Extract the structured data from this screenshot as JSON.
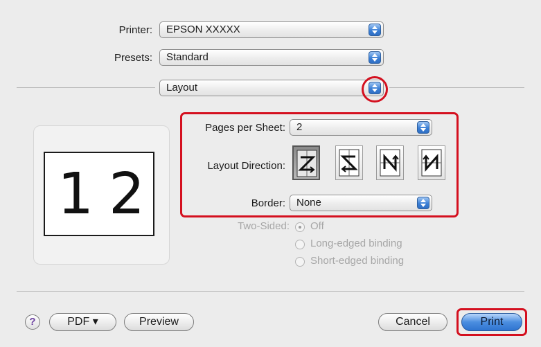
{
  "printer": {
    "label": "Printer:",
    "value": "EPSON XXXXX"
  },
  "presets": {
    "label": "Presets:",
    "value": "Standard"
  },
  "panel_menu": {
    "value": "Layout"
  },
  "layout": {
    "pages_per_sheet": {
      "label": "Pages per Sheet:",
      "value": "2"
    },
    "layout_direction": {
      "label": "Layout Direction:",
      "selected_index": 0,
      "options": [
        "z-pattern-icon",
        "reverse-z-pattern-icon",
        "n-pattern-icon",
        "reverse-n-pattern-icon"
      ]
    },
    "border": {
      "label": "Border:",
      "value": "None"
    },
    "two_sided": {
      "label": "Two-Sided:",
      "options": [
        "Off",
        "Long-edged binding",
        "Short-edged binding"
      ],
      "selected": "Off",
      "enabled": false
    }
  },
  "preview": {
    "page_numbers": [
      "1",
      "2"
    ]
  },
  "footer": {
    "help_label": "?",
    "pdf_label": "PDF ▾",
    "preview_label": "Preview",
    "cancel_label": "Cancel",
    "print_label": "Print"
  },
  "colors": {
    "highlight": "#d4101f",
    "accent": "#3b7fd6"
  }
}
